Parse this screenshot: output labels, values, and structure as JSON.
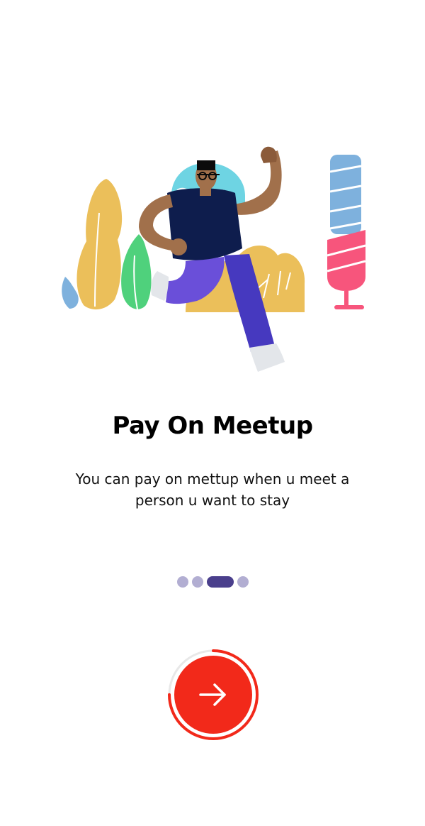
{
  "onboarding": {
    "title": "Pay On Meetup",
    "description": "You can pay on mettup when u meet  a person u want to stay",
    "illustration": "person-running-illustration",
    "pager": {
      "total": 4,
      "active_index": 2,
      "inactive_color": "#b2aed2",
      "active_color": "#4a3f8c"
    },
    "next_button": {
      "icon": "arrow-right-icon",
      "color": "#f2291a",
      "progress": 0.75
    }
  }
}
